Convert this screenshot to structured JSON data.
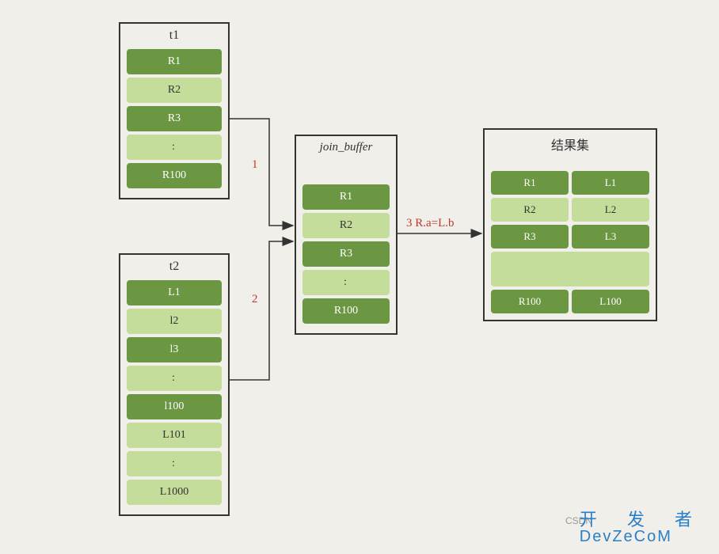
{
  "boxes": {
    "t1": {
      "title": "t1",
      "rows": [
        "R1",
        "R2",
        "R3",
        ":",
        "R100"
      ],
      "styles": [
        "dark",
        "light",
        "dark",
        "dots",
        "dark"
      ]
    },
    "t2": {
      "title": "t2",
      "rows": [
        "L1",
        "l2",
        "l3",
        ":",
        "l100",
        "L101",
        ":",
        "L1000"
      ],
      "styles": [
        "dark",
        "light",
        "dark",
        "dots",
        "dark",
        "light",
        "dots",
        "light"
      ]
    },
    "join": {
      "title": "join_buffer",
      "rows": [
        "R1",
        "R2",
        "R3",
        ":",
        "R100"
      ],
      "styles": [
        "dark",
        "light",
        "dark",
        "dots",
        "dark"
      ]
    },
    "result": {
      "title": "结果集",
      "pairs": [
        {
          "l": "R1",
          "r": "L1",
          "style": "dark"
        },
        {
          "l": "R2",
          "r": "L2",
          "style": "light"
        },
        {
          "l": "R3",
          "r": "L3",
          "style": "dark"
        },
        {
          "gap": true
        },
        {
          "l": "R100",
          "r": "L100",
          "style": "dark"
        }
      ]
    }
  },
  "labels": {
    "arrow1": "1",
    "arrow2": "2",
    "arrow3": "3  R.a=L.b"
  },
  "watermark": {
    "csdn": "CSDN",
    "dev_zh": "开 发 者",
    "dev_en": "DevZеCoM"
  }
}
